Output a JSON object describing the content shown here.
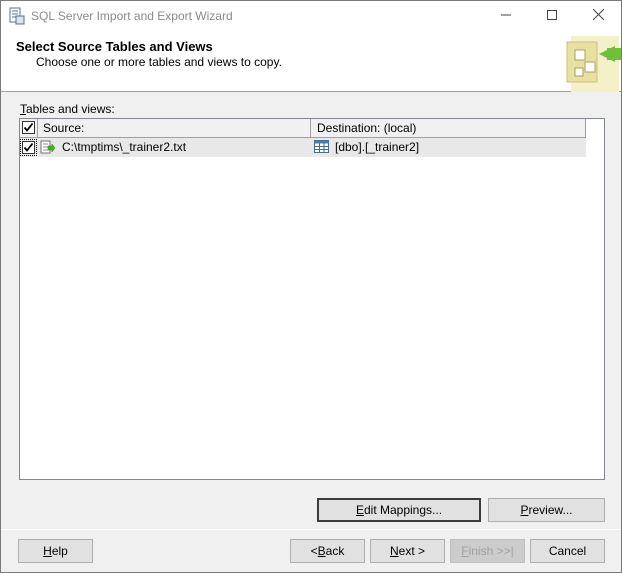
{
  "window": {
    "title": "SQL Server Import and Export Wizard"
  },
  "header": {
    "title": "Select Source Tables and Views",
    "subtitle": "Choose one or more tables and views to copy."
  },
  "tables": {
    "label_accel": "T",
    "label_rest": "ables and views:",
    "columns": {
      "source": "Source:",
      "destination": "Destination: (local)"
    },
    "rows": [
      {
        "checked": true,
        "source": "C:\\tmptims\\_trainer2.txt",
        "destination": "[dbo].[_trainer2]"
      }
    ]
  },
  "buttons": {
    "edit_mappings": {
      "accel": "E",
      "rest": "dit Mappings..."
    },
    "preview": {
      "accel": "P",
      "rest": "review..."
    },
    "help": {
      "accel": "H",
      "rest": "elp"
    },
    "back": {
      "pre": "< ",
      "accel": "B",
      "rest": "ack"
    },
    "next": {
      "accel": "N",
      "rest": "ext >"
    },
    "finish": {
      "accel": "F",
      "rest": "inish >>|"
    },
    "cancel": {
      "label": "Cancel"
    }
  },
  "icons": {
    "app": "wizard-app-icon",
    "header_graphic": "wizard-header-graphic",
    "source_file": "flat-file-source-icon",
    "destination_table": "table-icon"
  },
  "colors": {
    "title_text": "#8a8a8a",
    "row_background": "#e8e8e8",
    "button_face": "#e1e1e1"
  }
}
